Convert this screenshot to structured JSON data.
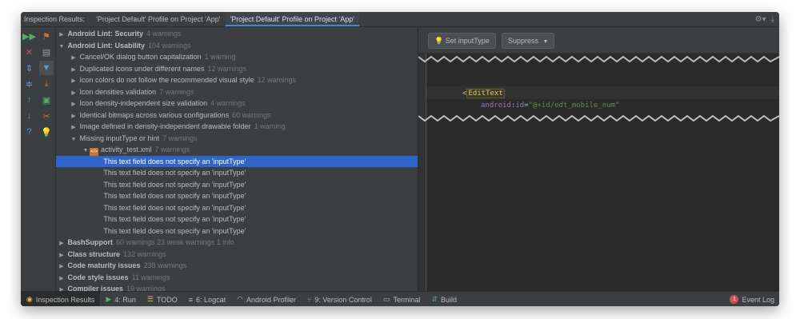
{
  "header": {
    "title": "Inspection Results:",
    "tabs": [
      {
        "label": "'Project Default' Profile on Project 'App'",
        "active": false
      },
      {
        "label": "'Project Default' Profile on Project 'App'",
        "active": true
      }
    ],
    "tools": {
      "settings_icon": "gear-icon",
      "hide_icon": "hide-icon"
    }
  },
  "toolbar_left": [
    {
      "icon": "rerun-icon",
      "glyph": "▶▶",
      "color": "#59a869"
    },
    {
      "icon": "close-icon",
      "glyph": "✕",
      "color": "#c75450"
    },
    {
      "icon": "expand-all-icon",
      "glyph": "⇕",
      "color": "#6e9fcf"
    },
    {
      "icon": "collapse-all-icon",
      "glyph": "≑",
      "color": "#6e9fcf"
    },
    {
      "icon": "previous-icon",
      "glyph": "↑",
      "color": "#4a9fe0"
    },
    {
      "icon": "next-icon",
      "glyph": "↓",
      "color": "#4a9fe0"
    },
    {
      "icon": "help-icon",
      "glyph": "?",
      "color": "#4a9fe0"
    }
  ],
  "toolbar_right": [
    {
      "icon": "group-by-severity-icon",
      "glyph": "⚑",
      "color": "#c57633",
      "selected": false
    },
    {
      "icon": "group-by-directory-icon",
      "glyph": "▤",
      "color": "#9a9a9a",
      "selected": false
    },
    {
      "icon": "filter-icon",
      "glyph": "▼",
      "color": "#4a9fe0",
      "selected": true
    },
    {
      "icon": "export-icon",
      "glyph": "⤓",
      "color": "#c57633",
      "selected": false
    },
    {
      "icon": "edit-settings-icon",
      "glyph": "▣",
      "color": "#59a869",
      "selected": false
    },
    {
      "icon": "fix-icon",
      "glyph": "✂",
      "color": "#c57633",
      "selected": false
    },
    {
      "icon": "lightbulb-icon",
      "glyph": "💡",
      "color": "#e8b93e",
      "selected": false
    }
  ],
  "tree": [
    {
      "indent": 0,
      "arrow": "▶",
      "bold": true,
      "label": "Android Lint: Security",
      "count": "4 warnings"
    },
    {
      "indent": 0,
      "arrow": "▼",
      "bold": true,
      "label": "Android Lint: Usability",
      "count": "104 warnings"
    },
    {
      "indent": 1,
      "arrow": "▶",
      "bold": false,
      "label": "Cancel/OK dialog button capitalization",
      "count": "1 warning"
    },
    {
      "indent": 1,
      "arrow": "▶",
      "bold": false,
      "label": "Duplicated icons under different names",
      "count": "12 warnings"
    },
    {
      "indent": 1,
      "arrow": "▶",
      "bold": false,
      "label": "Icon colors do not follow the recommended visual style",
      "count": "12 warnings"
    },
    {
      "indent": 1,
      "arrow": "▶",
      "bold": false,
      "label": "Icon densities validation",
      "count": "7 warnings"
    },
    {
      "indent": 1,
      "arrow": "▶",
      "bold": false,
      "label": "Icon density-independent size validation",
      "count": "4 warnings"
    },
    {
      "indent": 1,
      "arrow": "▶",
      "bold": false,
      "label": "Identical bitmaps across various configurations",
      "count": "60 warnings"
    },
    {
      "indent": 1,
      "arrow": "▶",
      "bold": false,
      "label": "Image defined in density-independent drawable folder",
      "count": "1 warning"
    },
    {
      "indent": 1,
      "arrow": "▼",
      "bold": false,
      "label": "Missing inputType or hint",
      "count": "7 warnings"
    },
    {
      "indent": 2,
      "arrow": "▼",
      "bold": false,
      "xml": true,
      "label": "activity_test.xml",
      "count": "7 warnings"
    },
    {
      "indent": 3,
      "arrow": "",
      "bold": false,
      "label": "This text field does not specify an 'inputType'",
      "count": "",
      "selected": true
    },
    {
      "indent": 3,
      "arrow": "",
      "bold": false,
      "label": "This text field does not specify an 'inputType'",
      "count": ""
    },
    {
      "indent": 3,
      "arrow": "",
      "bold": false,
      "label": "This text field does not specify an 'inputType'",
      "count": ""
    },
    {
      "indent": 3,
      "arrow": "",
      "bold": false,
      "label": "This text field does not specify an 'inputType'",
      "count": ""
    },
    {
      "indent": 3,
      "arrow": "",
      "bold": false,
      "label": "This text field does not specify an 'inputType'",
      "count": ""
    },
    {
      "indent": 3,
      "arrow": "",
      "bold": false,
      "label": "This text field does not specify an 'inputType'",
      "count": ""
    },
    {
      "indent": 3,
      "arrow": "",
      "bold": false,
      "label": "This text field does not specify an 'inputType'",
      "count": ""
    },
    {
      "indent": 0,
      "arrow": "▶",
      "bold": true,
      "label": "BashSupport",
      "count": "60 warnings 23 weak warnings 1 info"
    },
    {
      "indent": 0,
      "arrow": "▶",
      "bold": true,
      "label": "Class structure",
      "count": "132 warnings"
    },
    {
      "indent": 0,
      "arrow": "▶",
      "bold": true,
      "label": "Code maturity issues",
      "count": "238 warnings"
    },
    {
      "indent": 0,
      "arrow": "▶",
      "bold": true,
      "label": "Code style issues",
      "count": "11 warnings"
    },
    {
      "indent": 0,
      "arrow": "▶",
      "bold": true,
      "label": "Compiler issues",
      "count": "19 warnings"
    }
  ],
  "right_panel": {
    "set_input_type_button": "Set inputType",
    "suppress_button": "Suppress",
    "code": {
      "open_bracket": "<",
      "tag": "EditText",
      "attr_ns": "android",
      "attr_sep": ":",
      "attr_name": "id",
      "eq": "=",
      "attr_value": "\"@+id/edt_mobile_num\""
    }
  },
  "bottom_bar": {
    "items": [
      {
        "label": "Inspection Results",
        "icon": "inspection-icon",
        "glyph": "◉",
        "color": "#e8b93e",
        "active": true
      },
      {
        "label": "4: Run",
        "icon": "run-icon",
        "glyph": "▶",
        "color": "#59a869"
      },
      {
        "label": "TODO",
        "icon": "todo-icon",
        "glyph": "☰",
        "color": "#e8b93e"
      },
      {
        "label": "6: Logcat",
        "icon": "logcat-icon",
        "glyph": "≡",
        "color": "#bbbbbb"
      },
      {
        "label": "Android Profiler",
        "icon": "profiler-icon",
        "glyph": "◠",
        "color": "#bbbbbb"
      },
      {
        "label": "9: Version Control",
        "icon": "version-control-icon",
        "glyph": "⑂",
        "color": "#6e9fcf"
      },
      {
        "label": "Terminal",
        "icon": "terminal-icon",
        "glyph": "▭",
        "color": "#bbbbbb"
      },
      {
        "label": "Build",
        "icon": "build-icon",
        "glyph": "⇵",
        "color": "#59a869"
      }
    ],
    "event_log": {
      "label": "Event Log",
      "badge": "1"
    }
  }
}
